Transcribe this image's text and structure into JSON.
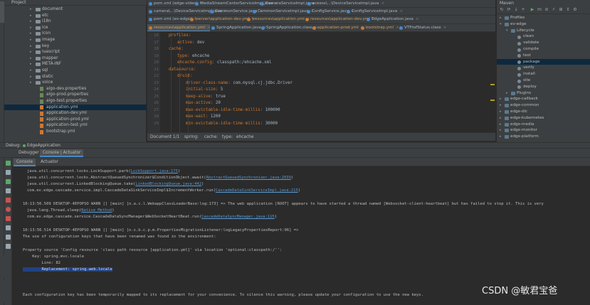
{
  "project_panel": {
    "title": "Project",
    "items": [
      {
        "label": "document",
        "type": "folder",
        "indent": 1
      },
      {
        "label": "etc",
        "type": "folder",
        "indent": 1
      },
      {
        "label": "i18n",
        "type": "folder",
        "indent": 1
      },
      {
        "label": "ice",
        "type": "folder",
        "indent": 1
      },
      {
        "label": "icon",
        "type": "folder",
        "indent": 1
      },
      {
        "label": "image",
        "type": "folder",
        "indent": 1
      },
      {
        "label": "key",
        "type": "folder",
        "indent": 1
      },
      {
        "label": "luascript",
        "type": "folder",
        "indent": 1
      },
      {
        "label": "mapper",
        "type": "folder",
        "indent": 1
      },
      {
        "label": "META-INF",
        "type": "folder",
        "indent": 1
      },
      {
        "label": "sql",
        "type": "folder",
        "indent": 1
      },
      {
        "label": "static",
        "type": "folder",
        "indent": 1
      },
      {
        "label": "voice",
        "type": "folder",
        "indent": 1
      },
      {
        "label": "algo-dev.properties",
        "type": "file",
        "indent": 0
      },
      {
        "label": "algo-prod.properties",
        "type": "file",
        "indent": 0
      },
      {
        "label": "algo-test.properties",
        "type": "file",
        "indent": 0
      },
      {
        "label": "application.yml",
        "type": "yml",
        "indent": 0,
        "selected": true
      },
      {
        "label": "application-dev.yml",
        "type": "yml",
        "indent": 0
      },
      {
        "label": "application-prod.yml",
        "type": "yml",
        "indent": 0
      },
      {
        "label": "application-test.yml",
        "type": "yml",
        "indent": 0
      },
      {
        "label": "bootstrap.yml",
        "type": "yml",
        "indent": 0
      }
    ]
  },
  "editor_tabs": {
    "row1": [
      {
        "label": "pom.xml (edge-video)",
        "color": "#4a88c7"
      },
      {
        "label": "MediaStreamCenterServiceImpl.java",
        "color": "#4a88c7"
      },
      {
        "label": "CameraServiceImpl.java",
        "color": "#4a88c7"
      },
      {
        "label": "access\\...\\DeviceServiceImpl.java",
        "color": "#4a88c7"
      }
    ],
    "row2": [
      {
        "label": "camera\\...\\DeviceServiceImpl.java",
        "color": "#4a88c7"
      },
      {
        "label": "CommonService.java",
        "color": "#4a88c7"
      },
      {
        "label": "CommonServiceImpl.java",
        "color": "#4a88c7"
      },
      {
        "label": "ConfigService.java",
        "color": "#4a88c7"
      },
      {
        "label": "ConfigServiceImpl.java",
        "color": "#4a88c7"
      }
    ],
    "row3": [
      {
        "label": "pom.xml (ev-edge)",
        "color": "#4a88c7"
      },
      {
        "label": "\\server\\application-dev.yml",
        "color": "#cc7832"
      },
      {
        "label": "\\resources\\application.yml",
        "color": "#cc7832"
      },
      {
        "label": "resources\\application-dev.yml",
        "color": "#cc7832"
      },
      {
        "label": "EdgeApplication.java",
        "color": "#4a88c7"
      }
    ],
    "row4": [
      {
        "label": "resources\\application.yml",
        "color": "#cc7832",
        "active": true
      },
      {
        "label": "SpringApplication.java",
        "color": "#4a88c7"
      },
      {
        "label": "SpringApplication.class",
        "color": "#4a88c7"
      },
      {
        "label": "application-prod.yml",
        "color": "#cc7832"
      },
      {
        "label": "bootstrap.yml",
        "color": "#cc7832"
      },
      {
        "label": "VTProfStatus.class",
        "color": "#4a88c7"
      }
    ]
  },
  "editor": {
    "lines": [
      {
        "no": "16",
        "indent": 1,
        "key": "profiles:",
        "value": ""
      },
      {
        "no": "17",
        "indent": 2,
        "key": "active:",
        "value": " dev"
      },
      {
        "no": "18",
        "indent": 1,
        "key": "cache:",
        "value": ""
      },
      {
        "no": "19",
        "indent": 2,
        "key": "type:",
        "value": " ehcache"
      },
      {
        "no": "20",
        "indent": 2,
        "key": "ehcache.config:",
        "value": " classpath:/ehcache.xml"
      },
      {
        "no": "21",
        "indent": 1,
        "key": "datasource:",
        "value": ""
      },
      {
        "no": "22",
        "indent": 2,
        "key": "druid:",
        "value": ""
      },
      {
        "no": "23",
        "indent": 3,
        "key": "driver-class-name:",
        "value": " com.mysql.cj.jdbc.Driver"
      },
      {
        "no": "24",
        "indent": 3,
        "key": "initial-size:",
        "value": " 5"
      },
      {
        "no": "25",
        "indent": 3,
        "key": "keep-alive:",
        "value": " true"
      },
      {
        "no": "26",
        "indent": 3,
        "key": "max-active:",
        "value": " 20"
      },
      {
        "no": "27",
        "indent": 3,
        "key": "max-evictable-idle-time-millis:",
        "value": " 100000"
      },
      {
        "no": "28",
        "indent": 3,
        "key": "max-wait:",
        "value": " 1200"
      },
      {
        "no": "29",
        "indent": 3,
        "key": "min-evictable-idle-time-millis:",
        "value": " 30000"
      }
    ],
    "breadcrumb": [
      "Document 1/1",
      "spring:",
      "cache:",
      "type:",
      "ehcache"
    ]
  },
  "maven": {
    "title": "Maven",
    "items": [
      {
        "label": "Profiles",
        "kind": "folder",
        "level": 0,
        "arrow": "▸"
      },
      {
        "label": "ev-edge",
        "kind": "module",
        "level": 0,
        "arrow": "▾"
      },
      {
        "label": "Lifecycle",
        "kind": "folder",
        "level": 1,
        "arrow": "▾"
      },
      {
        "label": "clean",
        "kind": "goal",
        "level": 2
      },
      {
        "label": "validate",
        "kind": "goal",
        "level": 2
      },
      {
        "label": "compile",
        "kind": "goal",
        "level": 2
      },
      {
        "label": "test",
        "kind": "goal",
        "level": 2
      },
      {
        "label": "package",
        "kind": "goal",
        "level": 2,
        "selected": true
      },
      {
        "label": "verify",
        "kind": "goal",
        "level": 2
      },
      {
        "label": "install",
        "kind": "goal",
        "level": 2
      },
      {
        "label": "site",
        "kind": "goal",
        "level": 2
      },
      {
        "label": "deploy",
        "kind": "goal",
        "level": 2
      },
      {
        "label": "Plugins",
        "kind": "folder",
        "level": 1,
        "arrow": "▸"
      },
      {
        "label": "edge-callback",
        "kind": "module",
        "level": 0,
        "arrow": "▸"
      },
      {
        "label": "edge-common",
        "kind": "module",
        "level": 0,
        "arrow": "▸"
      },
      {
        "label": "edge-dlc",
        "kind": "module",
        "level": 0,
        "arrow": "▸"
      },
      {
        "label": "edge-kubernetes",
        "kind": "module",
        "level": 0,
        "arrow": "▸"
      },
      {
        "label": "edge-media",
        "kind": "module",
        "level": 0,
        "arrow": "▸"
      },
      {
        "label": "edge-monitor",
        "kind": "module",
        "level": 0,
        "arrow": "▸"
      },
      {
        "label": "edge-platform",
        "kind": "module",
        "level": 0,
        "arrow": "▸"
      }
    ]
  },
  "debug": {
    "label": "Debug:",
    "run_config": "EdgeApplication",
    "tabs": [
      "Debugger",
      "Console | Actuator"
    ],
    "console_tabs": [
      "Console",
      "Actuator"
    ]
  },
  "console": {
    "lines": [
      {
        "text": "java.util.concurrent.locks.LockSupport.park(",
        "link": "LockSupport.java:175",
        "tail": ")"
      },
      {
        "text": "java.util.concurrent.locks.AbstractQueuedSynchronizer$ConditionObject.await(",
        "link": "AbstractQueuedSynchronizer.java:2039",
        "tail": ")"
      },
      {
        "text": "java.util.concurrent.LinkedBlockingQueue.take(",
        "link": "LinkedBlockingQueue.java:442",
        "tail": ")"
      },
      {
        "text": "com.ev.edge.cascade.service.impl.CascadeDataSinkServiceImpl$IncrementWorker.run(",
        "link": "CascadeDataSinkServiceImpl.java:215",
        "tail": ")"
      },
      {
        "text": "",
        "link": "",
        "tail": ""
      },
      {
        "text": "10:13:56.509 DESKTOP-4EPOPSO WARN [] [main] [o.a.c.l.WebappClassLoaderBase:log:173] => The web application [ROOT] appears to have started a thread named [Websocket-client-heartbeat] but has failed to stop it. This is very",
        "link": "",
        "tail": ""
      },
      {
        "text": "java.lang.Thread.sleep(",
        "link": "Native Method",
        "tail": ")"
      },
      {
        "text": "com.ev.edge.cascade.service.CascadeDataSyncManager$WebSocketHeartBeat.run(",
        "link": "CascadeDataSyncManager.java:115",
        "tail": ")"
      },
      {
        "text": "",
        "link": "",
        "tail": ""
      },
      {
        "text": "10:13:56.514 DESKTOP-4EPOPSO WARN [] [main] [o.s.b.c.p.m.PropertiesMigrationListener:logLegacyPropertiesReport:96] =>",
        "link": "",
        "tail": ""
      },
      {
        "text": "The use of configuration keys that have been renamed was found in the environment:",
        "link": "",
        "tail": ""
      },
      {
        "text": "",
        "link": "",
        "tail": ""
      },
      {
        "text": "Property source 'Config resource 'class path resource [application.yml]' via location 'optional:classpath:/'':",
        "link": "",
        "tail": ""
      },
      {
        "text": "    Key: spring.mvc.locale",
        "link": "",
        "tail": ""
      },
      {
        "text": "        Line: 82",
        "link": "",
        "tail": ""
      },
      {
        "text": "        Replacement: spring.web.locale",
        "link": "",
        "tail": "",
        "highlight": true
      },
      {
        "text": "",
        "link": "",
        "tail": ""
      },
      {
        "text": "",
        "link": "",
        "tail": ""
      },
      {
        "text": "Each configuration key has been temporarily mapped to its replacement for your convenience. To silence this warning, please update your configuration to use the new keys.",
        "link": "",
        "tail": ""
      }
    ]
  },
  "watermark": "CSDN @敏君宝爸"
}
